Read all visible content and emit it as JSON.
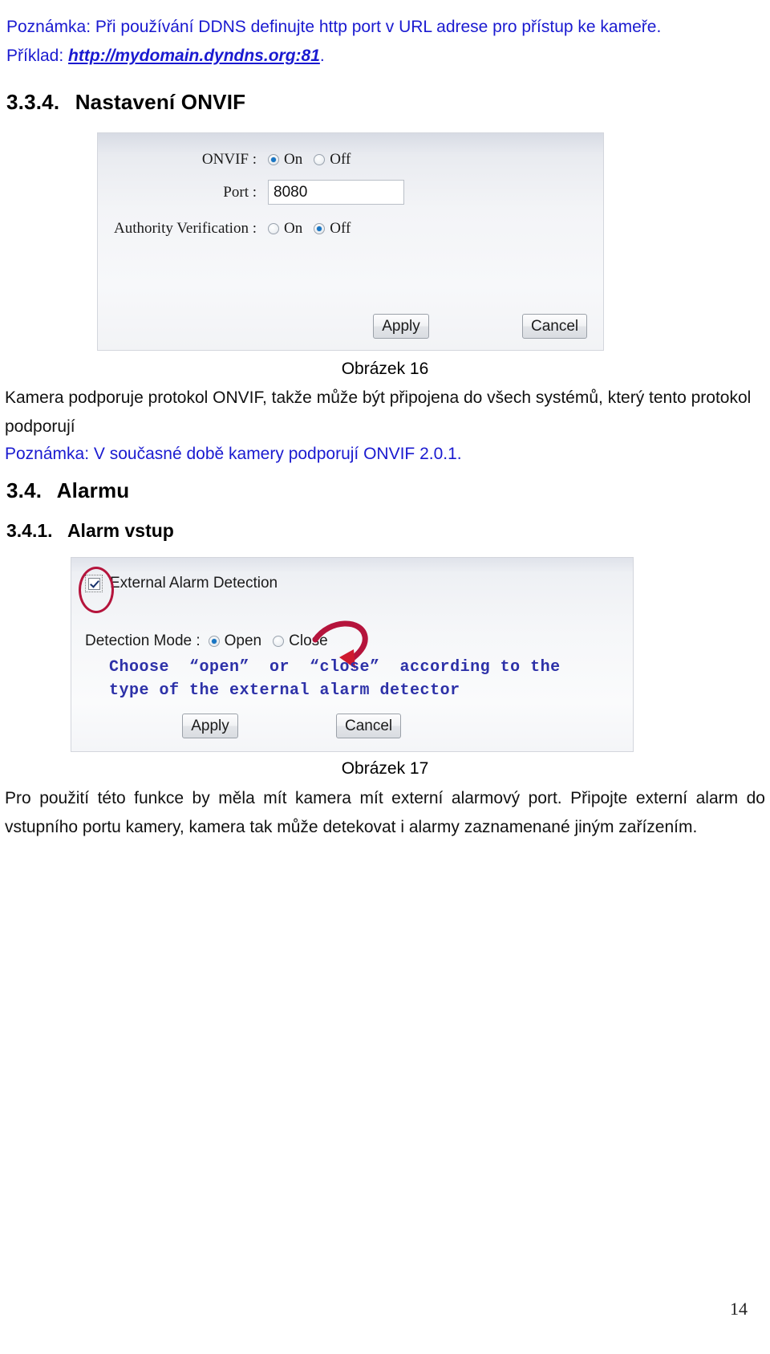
{
  "document": {
    "page_number": "14"
  },
  "note_ddns": {
    "line1_prefix": "Poznámka: Při používání DDNS definujte http port v URL adrese pro přístup ke kameře.",
    "line2_prefix": "Příklad: ",
    "link": "http://mydomain.dyndns.org:81",
    "line2_suffix": "."
  },
  "heading_334": {
    "number": "3.3.4.",
    "title": "Nastavení ONVIF"
  },
  "onvif_panel": {
    "rows": [
      {
        "label": "ONVIF :",
        "options": [
          {
            "label": "On",
            "selected": true
          },
          {
            "label": "Off",
            "selected": false
          }
        ]
      },
      {
        "label": "Port :",
        "value": "8080",
        "placeholder": "8080"
      },
      {
        "label": "Authority Verification :",
        "options": [
          {
            "label": "On",
            "selected": false
          },
          {
            "label": "Off",
            "selected": true
          }
        ]
      }
    ],
    "apply_label": "Apply",
    "cancel_label": "Cancel"
  },
  "caption_16": "Obrázek 16",
  "para_onvif": "Kamera podporuje protokol ONVIF, takže může být připojena do všech systémů, který tento protokol podporují",
  "note_onvif": "Poznámka: V současné době kamery podporují ONVIF 2.0.1.",
  "heading_34": {
    "number": "3.4.",
    "title": "Alarmu"
  },
  "heading_341": {
    "number": "3.4.1.",
    "title": "Alarm vstup"
  },
  "alarm_panel": {
    "checkbox": {
      "label": "External Alarm Detection",
      "checked": true
    },
    "detection_mode": {
      "label": "Detection Mode :",
      "options": [
        {
          "label": "Open",
          "selected": true
        },
        {
          "label": "Close",
          "selected": false
        }
      ]
    },
    "annotation_text_line1": "Choose  “open”  or  “close”  according to the",
    "annotation_text_line2": "type of the external alarm detector",
    "apply_label": "Apply",
    "cancel_label": "Cancel"
  },
  "caption_17": "Obrázek 17",
  "para_alarm": "Pro použití této funkce by měla mít kamera mít externí alarmový port. Připojte externí alarm do vstupního portu kamery, kamera tak může detekovat i alarmy zaznamenané jiným zařízením.",
  "colors": {
    "note_blue": "#1a1ad0",
    "annotation_blue": "#2d31a8",
    "annotation_red": "#b5143c",
    "radio_accent": "#1976c4"
  }
}
